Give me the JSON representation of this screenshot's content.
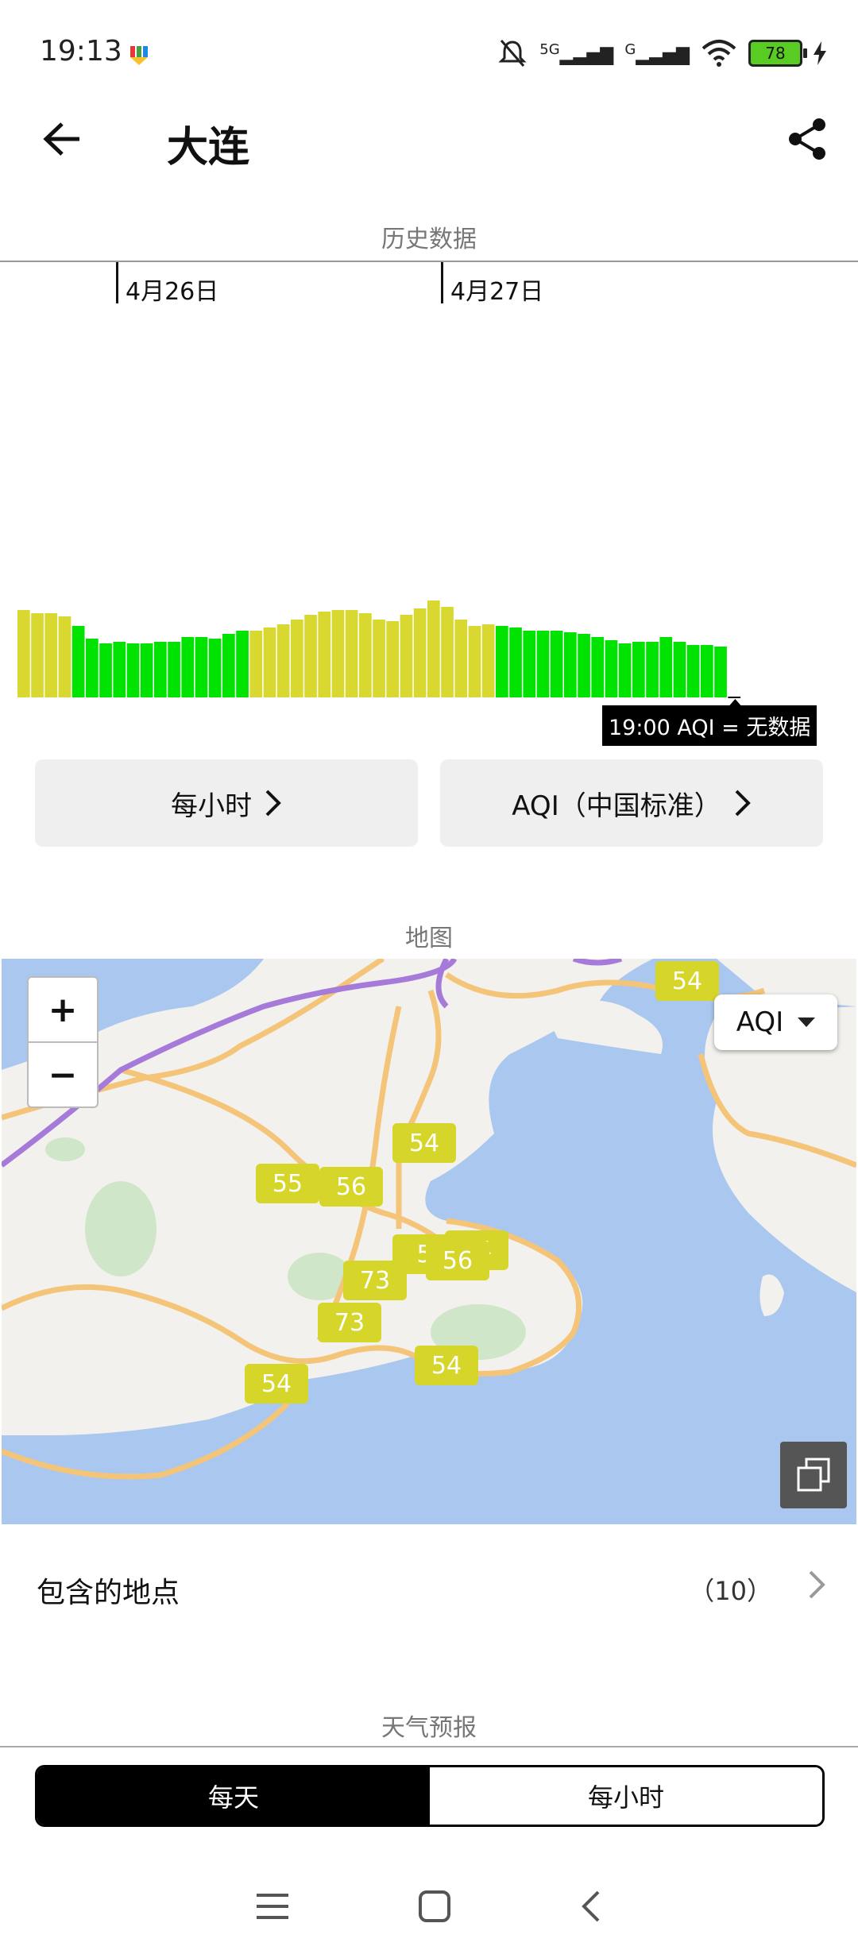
{
  "status_bar": {
    "time": "19:13",
    "signal_1": "5G",
    "signal_2": "G",
    "battery": "78"
  },
  "header": {
    "title": "大连",
    "back_icon": "arrow-left-icon",
    "share_icon": "share-icon"
  },
  "history": {
    "section_title": "历史数据",
    "date_labels": [
      "4月26日",
      "4月27日"
    ],
    "tooltip": "19:00 AQI = 无数据",
    "button_interval": "每小时",
    "button_standard": "AQI（中国标准）"
  },
  "chart_data": {
    "type": "bar",
    "values": [
      55,
      53,
      53,
      51,
      45,
      37,
      34,
      35,
      34,
      34,
      35,
      35,
      38,
      38,
      37,
      40,
      42,
      42,
      44,
      46,
      49,
      52,
      54,
      55,
      55,
      53,
      49,
      48,
      52,
      56,
      61,
      57,
      49,
      45,
      46,
      45,
      44,
      42,
      42,
      42,
      41,
      40,
      38,
      36,
      34,
      35,
      35,
      38,
      35,
      33,
      33,
      32,
      0
    ],
    "colors": [
      "#d8d830",
      "#00e300"
    ],
    "green_indices": [
      4,
      5,
      6,
      7,
      8,
      9,
      10,
      11,
      12,
      13,
      14,
      15,
      16,
      35,
      36,
      37,
      38,
      39,
      40,
      41,
      42,
      43,
      44,
      45,
      46,
      47,
      48,
      49,
      50,
      51
    ]
  },
  "map": {
    "section_title": "地图",
    "zoom_in": "+",
    "zoom_out": "−",
    "dropdown_label": "AQI",
    "markers": [
      "54",
      "54",
      "55",
      "56",
      "5",
      "54",
      "56",
      "73",
      "73",
      "54",
      "54"
    ],
    "marker_color": "#d6d62a",
    "water_color": "#aac8ef",
    "road_color": "#f4c478"
  },
  "places": {
    "label": "包含的地点",
    "count": "（10）"
  },
  "forecast": {
    "section_title": "天气预报",
    "tab_daily": "每天",
    "tab_hourly": "每小时"
  }
}
